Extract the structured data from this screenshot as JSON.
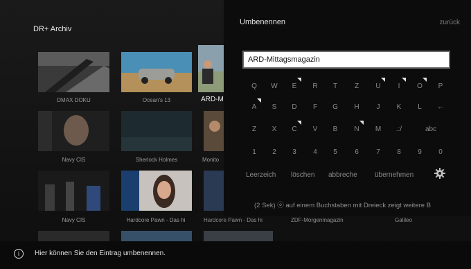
{
  "header": {
    "app_title": "DR+ Archiv"
  },
  "grid": {
    "row1": [
      "DMAX DOKU",
      "Ocean's 13",
      "ARD-M"
    ],
    "row2": [
      "Navy CIS",
      "Sherlock Holmes",
      "Monito"
    ],
    "row3": [
      "Navy CIS",
      "Hardcore Pawn - Das hi",
      "Hardcore Pawn - Das hi",
      "ZDF-Morgenmagazin",
      "Galileo"
    ]
  },
  "rename_dialog": {
    "title": "Umbenennen",
    "back_label": "zurück",
    "name_value": "ARD-Mittagsmagazin",
    "keyboard_rows": [
      [
        "Q",
        "W",
        "E",
        "R",
        "T",
        "Z",
        "U",
        "I",
        "O",
        "P"
      ],
      [
        "A",
        "S",
        "D",
        "F",
        "G",
        "H",
        "J",
        "K",
        "L",
        "←"
      ],
      [
        "Z",
        "X",
        "C",
        "V",
        "B",
        "N",
        "M",
        ".:/",
        "",
        "abc"
      ],
      [
        "1",
        "2",
        "3",
        "4",
        "5",
        "6",
        "7",
        "8",
        "9",
        "0"
      ]
    ],
    "actions": {
      "space": "Leerzeich",
      "delete": "löschen",
      "cancel": "abbreche",
      "apply": "übernehmen"
    },
    "settings_icon": "gear-icon",
    "hint": "(2 Sek) ⓞ auf einem Buchstaben mit Dreieck zeigt weitere B"
  },
  "status": {
    "icon": "info-icon",
    "text": "Hier können Sie den Eintrag umbenennen."
  },
  "colors": {
    "background": "#0b0b0b",
    "field_border": "#6a6a6a",
    "text_primary": "#e8e8e8",
    "text_muted": "#8a8a8a"
  }
}
